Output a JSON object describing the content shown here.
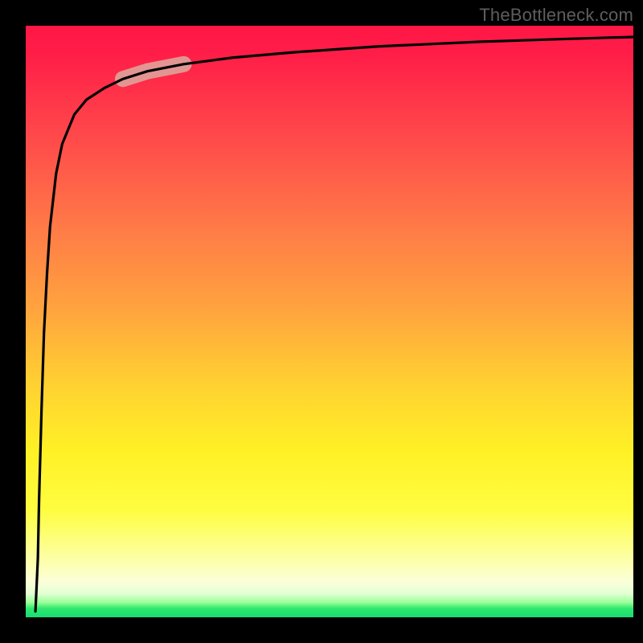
{
  "watermark": "TheBottleneck.com",
  "colors": {
    "frame": "#000000",
    "curve_stroke": "#000000",
    "highlight_fill": "#e0a098",
    "gradient_top": "#ff1646",
    "gradient_mid1": "#ffa43e",
    "gradient_mid2": "#fff126",
    "gradient_bottom": "#17dd73"
  },
  "chart_data": {
    "type": "line",
    "title": "",
    "xlabel": "",
    "ylabel": "",
    "xlim": [
      0,
      100
    ],
    "ylim": [
      0,
      100
    ],
    "grid": false,
    "legend": false,
    "annotations": [
      "TheBottleneck.com"
    ],
    "highlight_range_x": [
      16,
      26
    ],
    "series": [
      {
        "name": "curve",
        "x": [
          1.6,
          2.0,
          2.2,
          2.6,
          3.0,
          3.5,
          4.0,
          5.0,
          6.0,
          8.0,
          10.0,
          13.0,
          16.0,
          20.0,
          26.0,
          34.0,
          44.0,
          58.0,
          75.0,
          90.0,
          100.0
        ],
        "y": [
          1.0,
          10.0,
          20.0,
          35.0,
          48.0,
          58.0,
          66.0,
          75.0,
          80.0,
          85.0,
          87.5,
          89.5,
          91.0,
          92.3,
          93.5,
          94.6,
          95.5,
          96.5,
          97.3,
          97.8,
          98.1
        ]
      }
    ]
  }
}
